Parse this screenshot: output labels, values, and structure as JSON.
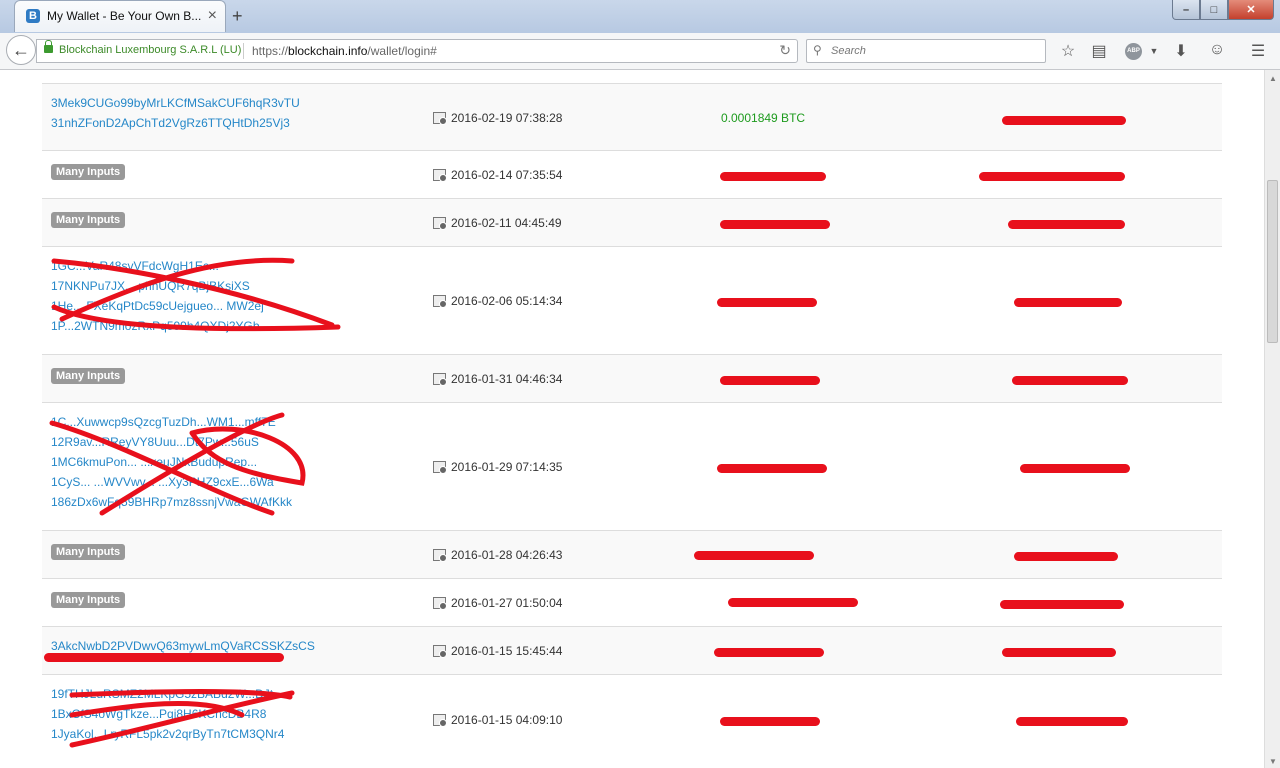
{
  "browser": {
    "tab_title": "My Wallet - Be Your Own B...",
    "favicon_letter": "B",
    "identity": "Blockchain Luxembourg S.A.R.L (LU)",
    "url_prefix": "https://",
    "url_domain": "blockchain.info",
    "url_path": "/wallet/login#",
    "search_placeholder": "Search",
    "abp_label": "ABP"
  },
  "transactions": [
    {
      "addresses": [
        "3Mek9CUGo99byMrLKCfMSakCUF6hqR3vTU",
        "31nhZFonD2ApChTd2VgRz6TTQHtDh25Vj3"
      ],
      "badge": "",
      "date": "2016-02-19 07:38:28",
      "amount": "0.0001849 BTC",
      "balance": "",
      "alt": true
    },
    {
      "addresses": [],
      "badge": "Many Inputs",
      "date": "2016-02-14 07:35:54",
      "amount": "",
      "balance": "",
      "alt": false
    },
    {
      "addresses": [],
      "badge": "Many Inputs",
      "date": "2016-02-11 04:45:49",
      "amount": "",
      "balance": "",
      "alt": true
    },
    {
      "addresses": [
        "1GC...VaR48svVFdcWgH1Ec...",
        "17NKNPu7JX... phnUQR7qBjBKsiXS",
        "1He... FXeKqPtDc59cUejgueo... MW2ej",
        "1P...2WTN9mozRxPq599h4QXDj2YGb..."
      ],
      "badge": "",
      "date": "2016-02-06 05:14:34",
      "amount": "",
      "balance": "",
      "alt": false
    },
    {
      "addresses": [],
      "badge": "Many Inputs",
      "date": "2016-01-31 04:46:34",
      "amount": "",
      "balance": "",
      "alt": true
    },
    {
      "addresses": [
        "1C...Xuwwcp9sQzcgTuzDh...WM1...mff7E",
        "12R9av...RReyVY8Uuu...Dt7Pw...56uS",
        "1MC6kmuPon... ...xeuJNxBudupRep...",
        "1CyS... ...WVVwv... ...Xy3PHZ9cxE...6Wa",
        "186zDx6wFq59BHRp7mz8ssnjVwaGWAfKkk"
      ],
      "badge": "",
      "date": "2016-01-29 07:14:35",
      "amount": "",
      "balance": "",
      "alt": false
    },
    {
      "addresses": [],
      "badge": "Many Inputs",
      "date": "2016-01-28 04:26:43",
      "amount": "",
      "balance": "",
      "alt": true
    },
    {
      "addresses": [],
      "badge": "Many Inputs",
      "date": "2016-01-27 01:50:04",
      "amount": "",
      "balance": "",
      "alt": false
    },
    {
      "addresses": [
        "3AkcNwbD2PVDwvQ63mywLmQVaRCSSKZsCS"
      ],
      "badge": "",
      "date": "2016-01-15 15:45:44",
      "amount": "",
      "balance": "",
      "alt": true
    },
    {
      "addresses": [
        "19fTHJLuRSMZ2MLKpG5zBABd2W...DJt",
        "1BxCfS4oWgTkze...Pqj8H6KCncDB4R8",
        "1JyaKol...LryRFL5pk2v2qrByTn7tCM3QNr4"
      ],
      "badge": "",
      "date": "2016-01-15 04:09:10",
      "amount": "",
      "balance": "",
      "alt": false
    }
  ]
}
